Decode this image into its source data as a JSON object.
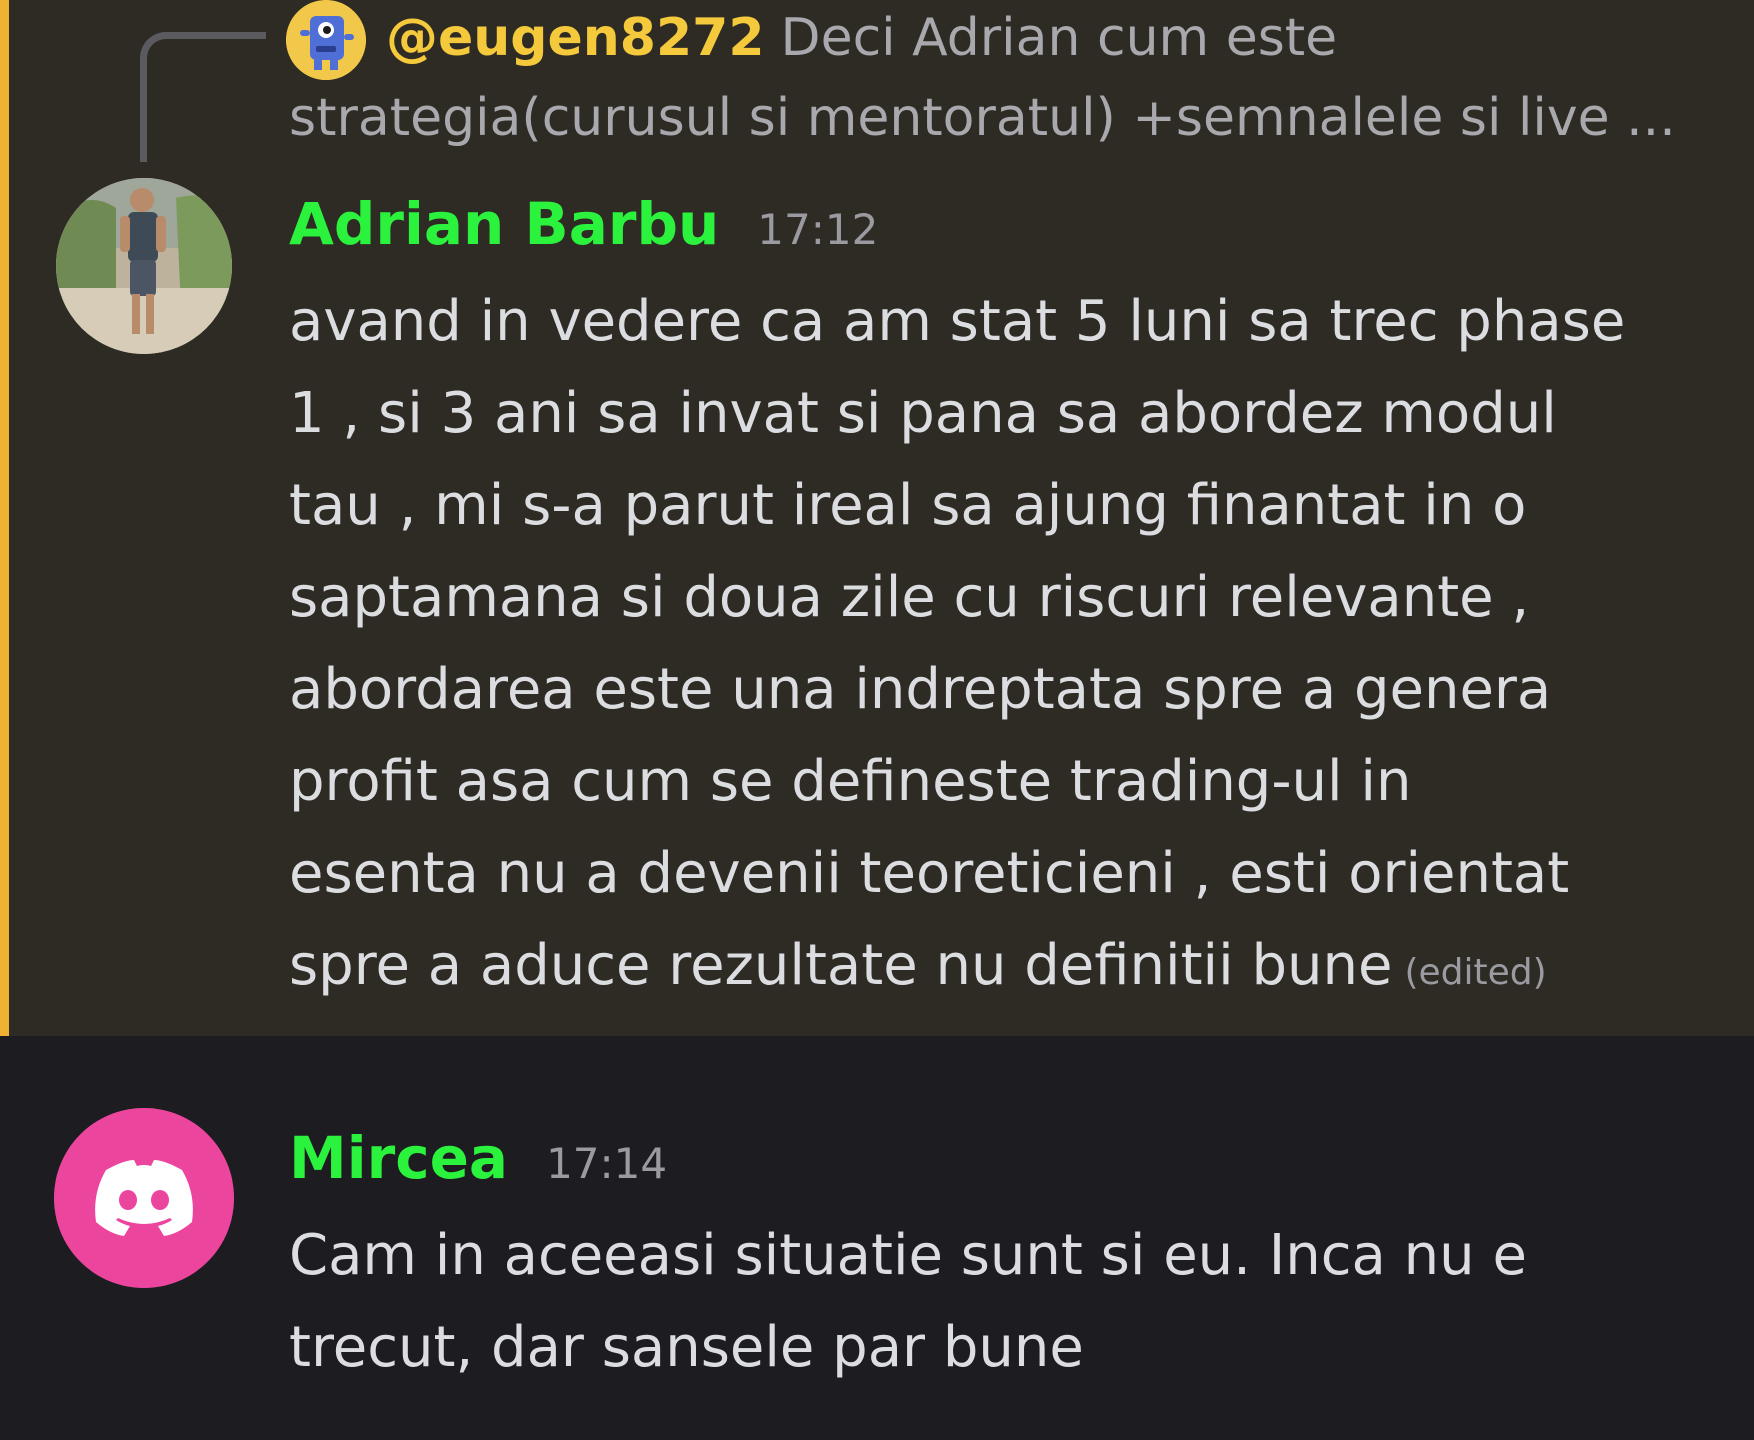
{
  "reply": {
    "author": "@eugen8272",
    "preview_line1": "Deci Adrian cum este",
    "preview_line2": "strategia(curusul si mentoratul) +semnalele si live ..."
  },
  "messages": [
    {
      "author": "Adrian Barbu",
      "time": "17:12",
      "lines": [
        "avand in vedere ca am stat 5 luni sa trec phase",
        "1 , si 3 ani sa invat si  pana sa abordez modul",
        "tau , mi s-a parut ireal sa ajung finantat in o",
        "saptamana si doua zile cu riscuri relevante ,",
        "abordarea este una indreptata spre a genera",
        "profit asa cum se defineste trading-ul in",
        "esenta nu a devenii teoreticieni , esti orientat",
        "spre a aduce rezultate  nu definitii bune"
      ],
      "edited_label": "(edited)",
      "highlighted": true
    },
    {
      "author": "Mircea",
      "time": "17:14",
      "lines": [
        "Cam in aceeasi situatie sunt si eu. Inca nu e",
        "trecut, dar sansele par bune"
      ]
    }
  ],
  "colors": {
    "background": "#1c1c21",
    "highlight_background": "#2e2b25",
    "highlight_bar": "#f0b232",
    "author_name": "#2bf23c",
    "reply_author": "#f5c93c",
    "discord_avatar": "#eb459e"
  },
  "icons": {
    "reply_avatar": "robot-avatar-icon",
    "mircea_avatar": "discord-logo-icon"
  }
}
